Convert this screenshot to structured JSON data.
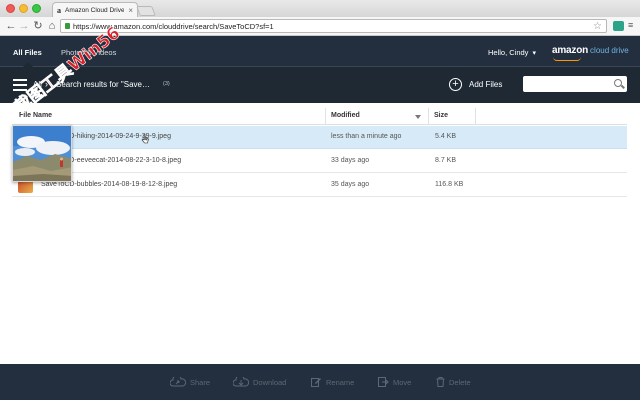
{
  "browser": {
    "tab_favicon": "a",
    "tab_title": "Amazon Cloud Drive",
    "tab_close": "×",
    "url": "https://www.amazon.com/clouddrive/search/SaveToCD?sf=1",
    "back_glyph": "←",
    "forward_glyph": "→",
    "reload_glyph": "↻",
    "home_glyph": "⌂",
    "star_glyph": "☆",
    "menu_glyph": "≡"
  },
  "header": {
    "tabs": [
      {
        "label": "All Files",
        "active": true
      },
      {
        "label": "Photos & Videos",
        "active": false
      }
    ],
    "greeting": "Hello, Cindy",
    "greeting_chevron": "▾",
    "brand_word": "amazon",
    "brand_product": "cloud drive"
  },
  "actionbar": {
    "breadcrumb": "All",
    "breadcrumb_sep": "›",
    "search_results_text": "Search results for \"Save…",
    "result_count": "(3)",
    "add_files_glyph": "+",
    "add_files_label": "Add Files",
    "search_placeholder": ""
  },
  "table": {
    "columns": [
      "File Name",
      "Modified",
      "Size"
    ],
    "rows": [
      {
        "name": "SaveToCD-hiking-2014-09-24-9-39-9.jpeg",
        "modified": "less than a minute ago",
        "size": "5.4 KB",
        "selected": true
      },
      {
        "name": "SaveToCD-eeveecat-2014-08-22-3-10-8.jpeg",
        "modified": "33 days ago",
        "size": "8.7 KB",
        "selected": false
      },
      {
        "name": "SaveToCD-bubbles-2014-08-19-8-12-8.jpeg",
        "modified": "35 days ago",
        "size": "116.8 KB",
        "selected": false
      }
    ]
  },
  "watermark_text": "截图工具Win56",
  "bottombar": {
    "share": "Share",
    "download": "Download",
    "rename": "Rename",
    "move": "Move",
    "delete": "Delete"
  },
  "colors": {
    "appbar": "#232f3e",
    "actionbar": "#1f2933",
    "selected_row": "#d7eaf8",
    "brand_orange": "#ff9900",
    "watermark_red": "#d9212b"
  }
}
